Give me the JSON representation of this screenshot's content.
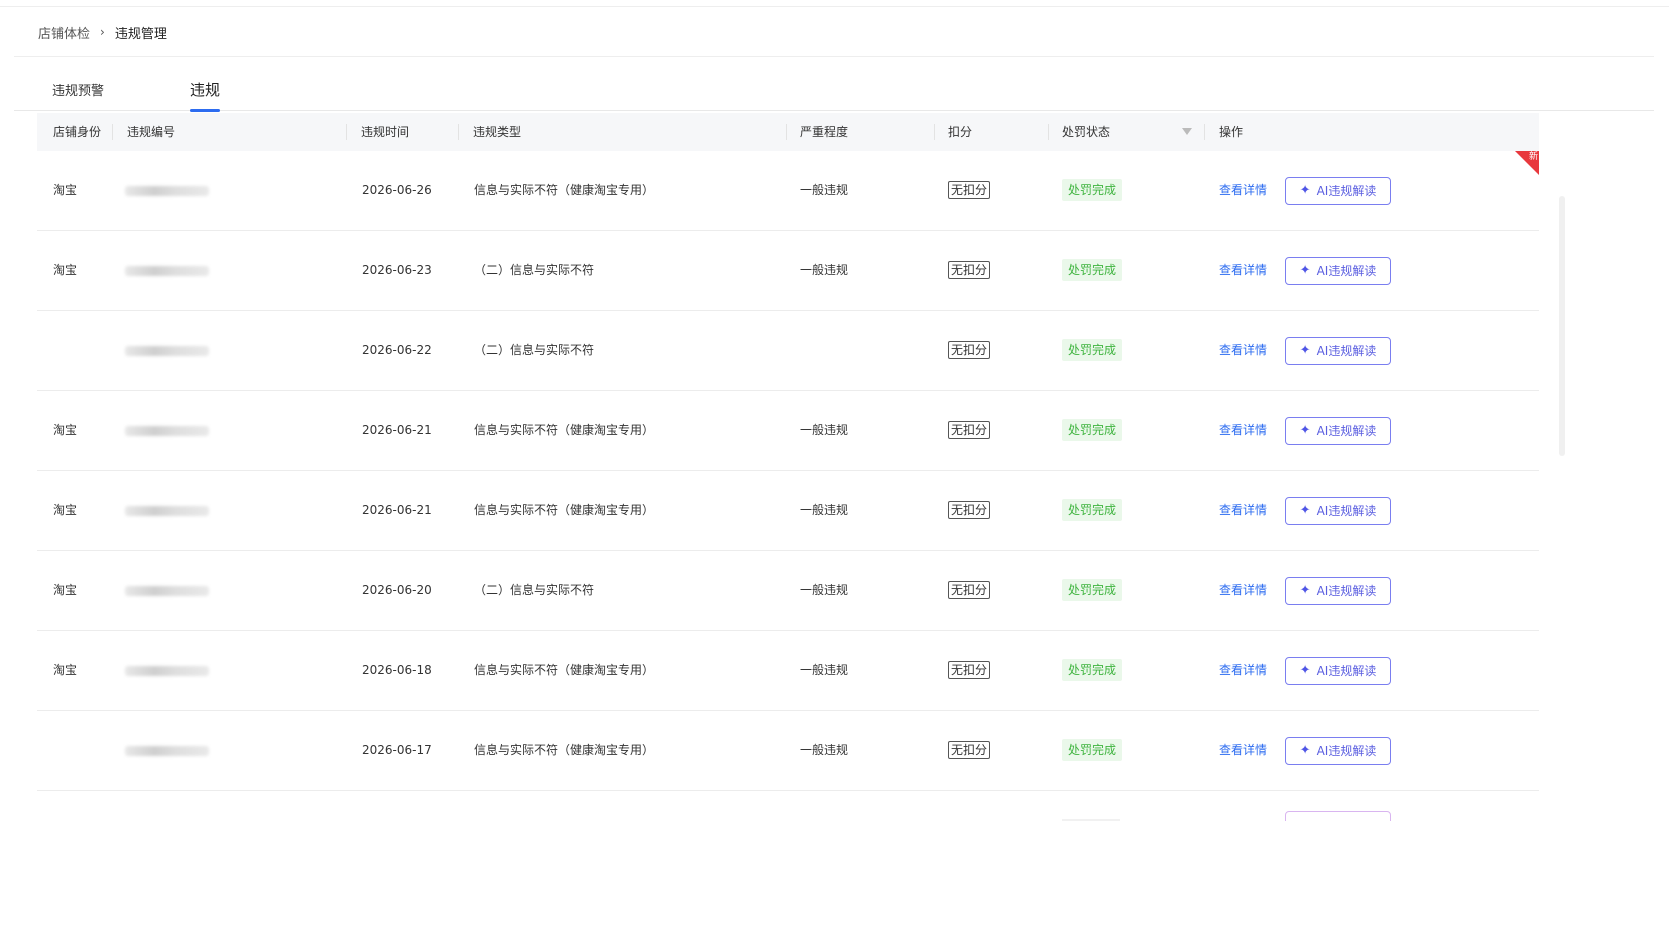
{
  "breadcrumb": {
    "parent": "店铺体检",
    "separator": "›",
    "current": "违规管理"
  },
  "tabs": [
    {
      "label": "违规预警",
      "active": false
    },
    {
      "label": "违规",
      "active": true
    }
  ],
  "table": {
    "columns": [
      "店铺身份",
      "违规编号",
      "违规时间",
      "违规类型",
      "严重程度",
      "扣分",
      "处罚状态",
      "操作"
    ],
    "rows": [
      {
        "shop": "淘宝",
        "time": "2026-06-26",
        "type": "信息与实际不符（健康淘宝专用）",
        "severity": "一般违规",
        "deduction": "无扣分",
        "status": "处罚完成",
        "detail": "查看详情",
        "ai": "AI违规解读",
        "is_new": true
      },
      {
        "shop": "淘宝",
        "time": "2026-06-23",
        "type": "（二）信息与实际不符",
        "severity": "一般违规",
        "deduction": "无扣分",
        "status": "处罚完成",
        "detail": "查看详情",
        "ai": "AI违规解读",
        "is_new": false
      },
      {
        "shop": "",
        "time": "2026-06-22",
        "type": "（二）信息与实际不符",
        "severity": "",
        "deduction": "无扣分",
        "status": "处罚完成",
        "detail": "查看详情",
        "ai": "AI违规解读",
        "is_new": false
      },
      {
        "shop": "淘宝",
        "time": "2026-06-21",
        "type": "信息与实际不符（健康淘宝专用）",
        "severity": "一般违规",
        "deduction": "无扣分",
        "status": "处罚完成",
        "detail": "查看详情",
        "ai": "AI违规解读",
        "is_new": false
      },
      {
        "shop": "淘宝",
        "time": "2026-06-21",
        "type": "信息与实际不符（健康淘宝专用）",
        "severity": "一般违规",
        "deduction": "无扣分",
        "status": "处罚完成",
        "detail": "查看详情",
        "ai": "AI违规解读",
        "is_new": false
      },
      {
        "shop": "淘宝",
        "time": "2026-06-20",
        "type": "（二）信息与实际不符",
        "severity": "一般违规",
        "deduction": "无扣分",
        "status": "处罚完成",
        "detail": "查看详情",
        "ai": "AI违规解读",
        "is_new": false
      },
      {
        "shop": "淘宝",
        "time": "2026-06-18",
        "type": "信息与实际不符（健康淘宝专用）",
        "severity": "一般违规",
        "deduction": "无扣分",
        "status": "处罚完成",
        "detail": "查看详情",
        "ai": "AI违规解读",
        "is_new": false
      },
      {
        "shop": "",
        "time": "2026-06-17",
        "type": "信息与实际不符（健康淘宝专用）",
        "severity": "一般违规",
        "deduction": "无扣分",
        "status": "处罚完成",
        "detail": "查看详情",
        "ai": "AI违规解读",
        "is_new": false
      }
    ],
    "new_badge": "新"
  },
  "icons": {
    "ai_button_icon": "sparkle-icon",
    "filter": "filter-icon"
  },
  "colors": {
    "link_blue": "#2d6cf0",
    "status_green": "#3fb43f",
    "ai_purple": "#5a5ee0",
    "new_red": "#e8383d"
  }
}
